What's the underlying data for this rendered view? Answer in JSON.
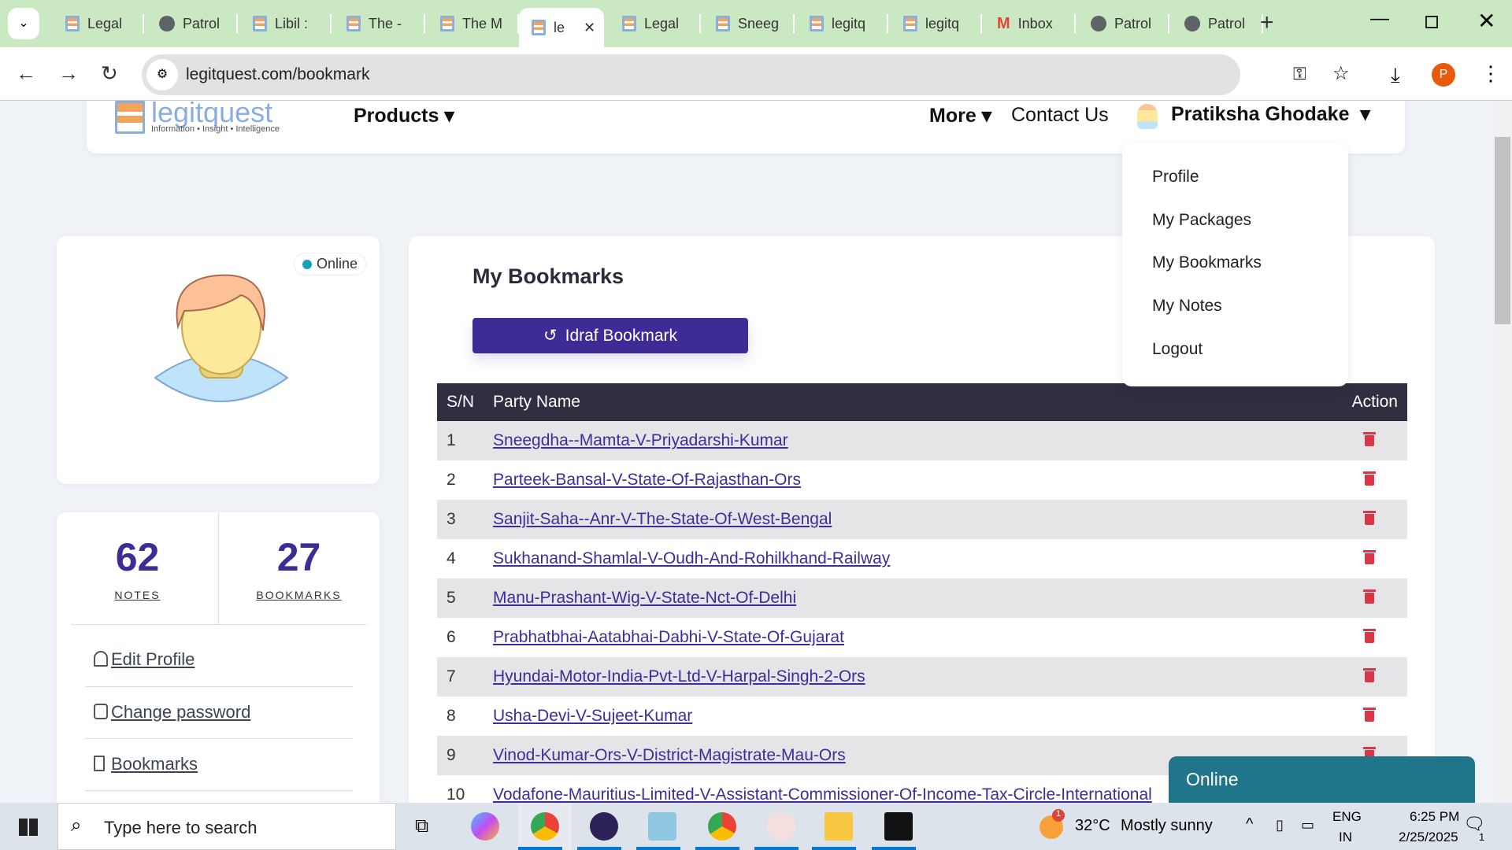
{
  "browser": {
    "tabs": [
      {
        "title": "Legal",
        "icon": "legitquest"
      },
      {
        "title": "Patrol",
        "icon": "globe"
      },
      {
        "title": "Libil :",
        "icon": "legitquest"
      },
      {
        "title": "The -",
        "icon": "legitquest"
      },
      {
        "title": "The M",
        "icon": "legitquest"
      },
      {
        "title": "le",
        "icon": "legitquest",
        "active": true
      },
      {
        "title": "Legal",
        "icon": "legitquest"
      },
      {
        "title": "Sneeg",
        "icon": "legitquest"
      },
      {
        "title": "legitq",
        "icon": "legitquest"
      },
      {
        "title": "legitq",
        "icon": "legitquest"
      },
      {
        "title": "Inbox",
        "icon": "gmail"
      },
      {
        "title": "Patrol",
        "icon": "globe"
      },
      {
        "title": "Patrol",
        "icon": "globe"
      }
    ],
    "url": "legitquest.com/bookmark",
    "profile_initial": "P"
  },
  "header": {
    "logo": "legitquest",
    "logo_tagline": "Information • Insight • Intelligence",
    "products": "Products",
    "more": "More",
    "contact": "Contact Us",
    "user": "Pratiksha Ghodake"
  },
  "dropdown": [
    "Profile",
    "My Packages",
    "My Bookmarks",
    "My Notes",
    "Logout"
  ],
  "profile": {
    "status": "Online",
    "notes_count": "62",
    "notes_label": "NOTES",
    "bookmarks_count": "27",
    "bookmarks_label": "BOOKMARKS",
    "links": [
      "Edit Profile",
      "Change password",
      "Bookmarks"
    ]
  },
  "main": {
    "title": "My Bookmarks",
    "button": "Idraf Bookmark",
    "columns": [
      "S/N",
      "Party Name",
      "Action"
    ],
    "rows": [
      [
        "1",
        "Sneegdha--Mamta-V-Priyadarshi-Kumar"
      ],
      [
        "2",
        "Parteek-Bansal-V-State-Of-Rajasthan-Ors"
      ],
      [
        "3",
        "Sanjit-Saha--Anr-V-The-State-Of-West-Bengal"
      ],
      [
        "4",
        "Sukhanand-Shamlal-V-Oudh-And-Rohilkhand-Railway"
      ],
      [
        "5",
        "Manu-Prashant-Wig-V-State-Nct-Of-Delhi"
      ],
      [
        "6",
        "Prabhatbhai-Aatabhai-Dabhi-V-State-Of-Gujarat"
      ],
      [
        "7",
        "Hyundai-Motor-India-Pvt-Ltd-V-Harpal-Singh-2-Ors"
      ],
      [
        "8",
        "Usha-Devi-V-Sujeet-Kumar"
      ],
      [
        "9",
        "Vinod-Kumar-Ors-V-District-Magistrate-Mau-Ors"
      ],
      [
        "10",
        "Vodafone-Mauritius-Limited-V-Assistant-Commissioner-Of-Income-Tax-Circle-International"
      ]
    ]
  },
  "chat": {
    "label": "Online"
  },
  "taskbar": {
    "search_placeholder": "Type here to search",
    "temp": "32°C",
    "weather": "Mostly sunny",
    "weather_badge": "1",
    "lang1": "ENG",
    "lang2": "IN",
    "time": "6:25 PM",
    "date": "2/25/2025",
    "notif": "1"
  },
  "colors": {
    "accent": "#3f2b96",
    "tabbar": "#cae8c1",
    "table_header": "#302e40",
    "chat": "#21758a",
    "delete": "#dc3545"
  }
}
